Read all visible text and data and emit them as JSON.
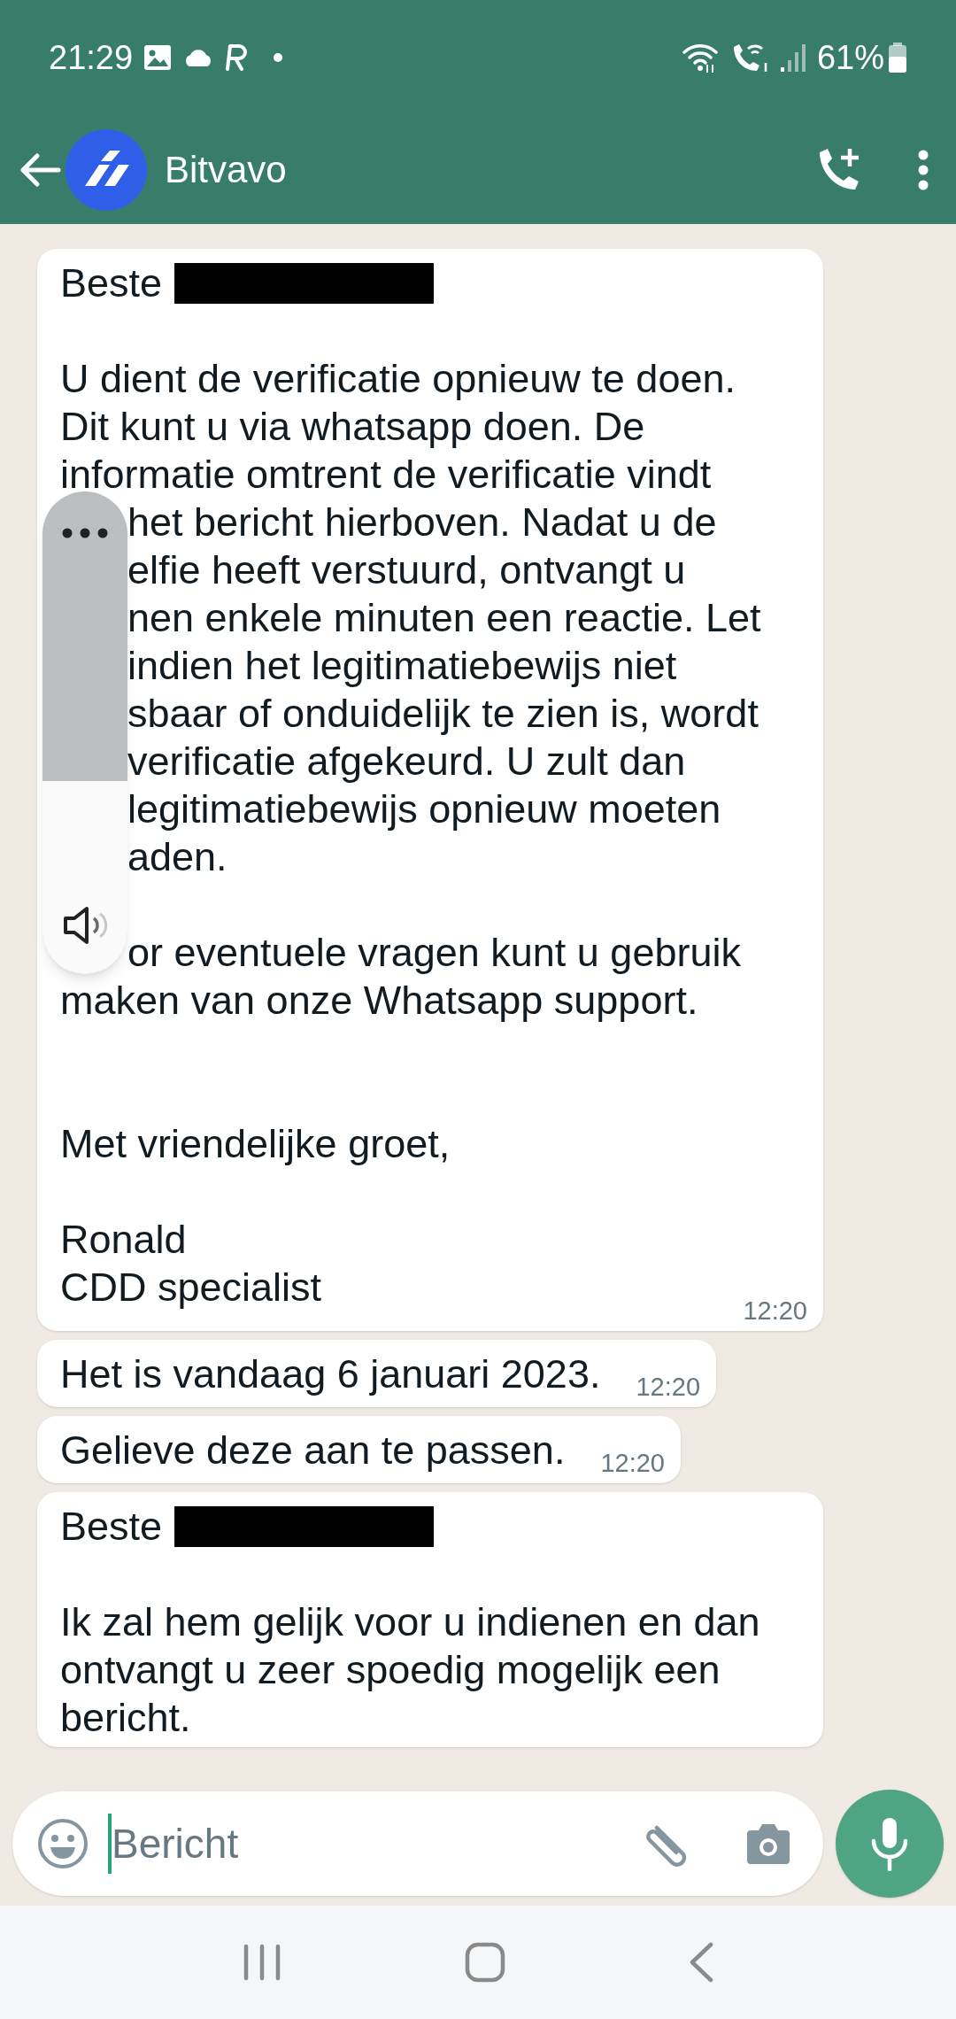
{
  "status_bar": {
    "time": "21:29",
    "battery": "61%"
  },
  "header": {
    "title": "Bitvavo"
  },
  "messages": [
    {
      "time": "12:20",
      "paragraphs": [
        {
          "kind": "body",
          "lines": [
            {
              "kind": "redacted",
              "text": "Beste"
            }
          ]
        },
        {
          "kind": "body",
          "lines": [
            {
              "kind": "plain",
              "text": "U dient de verificatie opnieuw te doen."
            },
            {
              "kind": "plain",
              "text": "Dit kunt u via whatsapp doen. De"
            },
            {
              "kind": "plain",
              "text": "informatie omtrent de verificatie vindt"
            },
            {
              "kind": "covered",
              "text": "het bericht hierboven. Nadat u de"
            },
            {
              "kind": "covered",
              "text": "elfie heeft verstuurd, ontvangt u"
            },
            {
              "kind": "covered",
              "text": "nen enkele minuten een reactie. Let"
            },
            {
              "kind": "covered",
              "text": "indien het legitimatiebewijs niet"
            },
            {
              "kind": "covered",
              "text": "sbaar of onduidelijk te zien is, wordt"
            },
            {
              "kind": "covered",
              "text": "verificatie afgekeurd. U zult dan"
            },
            {
              "kind": "covered",
              "text": "legitimatiebewijs opnieuw moeten"
            },
            {
              "kind": "covered",
              "text": "aden."
            }
          ]
        },
        {
          "kind": "body",
          "lines": [
            {
              "kind": "covered",
              "text": "or eventuele vragen kunt u gebruik"
            },
            {
              "kind": "plain",
              "text": "maken van onze Whatsapp support."
            }
          ]
        },
        {
          "kind": "closing",
          "lines": [
            {
              "kind": "plain",
              "text": "Met vriendelijke groet,"
            }
          ]
        },
        {
          "kind": "body",
          "lines": [
            {
              "kind": "plain",
              "text": "Ronald"
            },
            {
              "kind": "plain",
              "text": "CDD specialist"
            }
          ]
        }
      ]
    },
    {
      "time": "12:20",
      "paragraphs": [
        {
          "kind": "inline",
          "lines": [
            {
              "kind": "plain",
              "text": "Het is vandaag 6 januari 2023."
            }
          ]
        }
      ]
    },
    {
      "time": "12:20",
      "paragraphs": [
        {
          "kind": "inline",
          "lines": [
            {
              "kind": "plain",
              "text": "Gelieve deze aan te passen."
            }
          ]
        }
      ]
    },
    {
      "paragraphs": [
        {
          "kind": "body",
          "lines": [
            {
              "kind": "redacted",
              "text": "Beste"
            }
          ]
        },
        {
          "kind": "body",
          "lines": [
            {
              "kind": "plain",
              "text": "Ik zal hem gelijk voor u indienen en dan"
            },
            {
              "kind": "plain",
              "text": "ontvangt u zeer spoedig mogelijk een"
            },
            {
              "kind": "plain",
              "text": "bericht."
            }
          ]
        }
      ]
    }
  ],
  "volume_panel": {
    "level": 0.4
  },
  "composer": {
    "placeholder": "Bericht"
  }
}
